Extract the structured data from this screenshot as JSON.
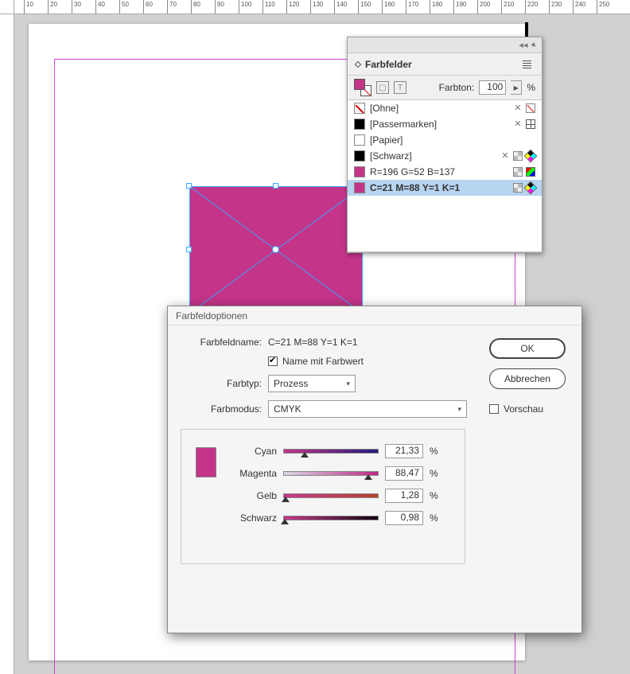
{
  "ruler": {
    "marks": [
      10,
      20,
      30,
      40,
      50,
      60,
      70,
      80,
      90,
      100,
      110,
      120,
      130,
      140,
      150,
      160,
      170,
      180,
      190,
      200,
      210,
      220,
      230,
      240,
      250
    ]
  },
  "swatches": {
    "title": "Farbfelder",
    "tint_label": "Farbton:",
    "tint_value": "100",
    "tint_unit": "%",
    "items": [
      {
        "name": "[Ohne]",
        "swatch_class": "none",
        "badges": [
          "x",
          "lockslash"
        ]
      },
      {
        "name": "[Passermarken]",
        "swatch_class": "reg",
        "badges": [
          "x",
          "reg"
        ]
      },
      {
        "name": "[Papier]",
        "swatch_class": "paper",
        "badges": []
      },
      {
        "name": "[Schwarz]",
        "swatch_class": "black",
        "badges": [
          "x",
          "gray",
          "cmyk"
        ]
      },
      {
        "name": "R=196 G=52 B=137",
        "swatch_class": "rgb",
        "badges": [
          "gray",
          "rgb"
        ]
      },
      {
        "name": "C=21 M=88 Y=1 K=1",
        "swatch_class": "cmyk",
        "badges": [
          "gray",
          "cmyk"
        ],
        "selected": true
      }
    ]
  },
  "dialog": {
    "title": "Farbfeldoptionen",
    "name_label": "Farbfeldname:",
    "name_value": "C=21 M=88 Y=1 K=1",
    "name_with_value": "Name mit Farbwert",
    "type_label": "Farbtyp:",
    "type_value": "Prozess",
    "mode_label": "Farbmodus:",
    "mode_value": "CMYK",
    "ok": "OK",
    "cancel": "Abbrechen",
    "preview": "Vorschau",
    "channels": [
      {
        "label": "Cyan",
        "value": "21,33",
        "pos": 21.33,
        "grad": "grad-cyan"
      },
      {
        "label": "Magenta",
        "value": "88,47",
        "pos": 88.47,
        "grad": "grad-mag"
      },
      {
        "label": "Gelb",
        "value": "1,28",
        "pos": 1.28,
        "grad": "grad-yel"
      },
      {
        "label": "Schwarz",
        "value": "0,98",
        "pos": 0.98,
        "grad": "grad-blk"
      }
    ],
    "pct": "%"
  }
}
